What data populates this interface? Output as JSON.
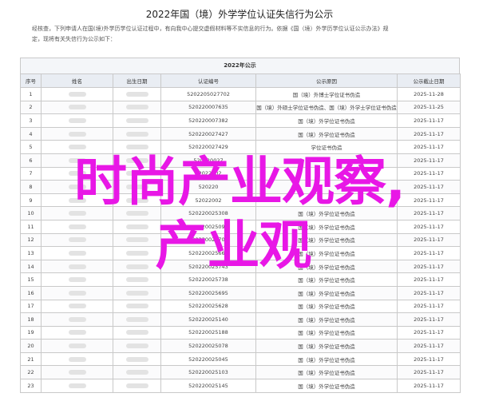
{
  "page": {
    "title": "2022年国（境）外学学位认证失信行为公示",
    "intro_line1": "经核查，下列申请人在国(境)外学历学位认证过程中，有向我中心提交虚假材料等不实信息的行为。依据《国（境）外学历学位认证公示办法》规",
    "intro_line2": "定，现将有关失信行为公示如下："
  },
  "table": {
    "caption": "2022年公示",
    "headers": [
      "序号",
      "姓名",
      "出生日期",
      "认证编号",
      "公示原因",
      "公示截止日期"
    ],
    "rows": [
      {
        "no": "1",
        "cert": "5202205027702",
        "reason": "国（境）外博士学位证书伪造",
        "date": "2025-11-28"
      },
      {
        "no": "2",
        "cert": "520220007635",
        "reason": "国（境）外硕士学位证书伪造、国（境）外学士学位证书伪造",
        "date": "2025-11-25"
      },
      {
        "no": "3",
        "cert": "520220007382",
        "reason": "国（境）外学位证书伪造",
        "date": "2025-11-17"
      },
      {
        "no": "4",
        "cert": "520220027427",
        "reason": "国（境）外学位证书伪造",
        "date": "2025-11-17"
      },
      {
        "no": "5",
        "cert": "520220027429",
        "reason": "学位证书伪造",
        "date": "2025-11-17"
      },
      {
        "no": "6",
        "cert": "520220027",
        "reason": "",
        "date": "2025-11-17"
      },
      {
        "no": "7",
        "cert": "52022002",
        "reason": "",
        "date": "2025-11-17"
      },
      {
        "no": "8",
        "cert": "520220",
        "reason": "",
        "date": "2025-11-17"
      },
      {
        "no": "9",
        "cert": "52022002",
        "reason": "",
        "date": "2025-11-17"
      },
      {
        "no": "10",
        "cert": "520220025308",
        "reason": "国（境）外学位证书伪造",
        "date": "2025-11-17"
      },
      {
        "no": "11",
        "cert": "520220025092",
        "reason": "国（境）外学位证书伪造",
        "date": "2025-11-17"
      },
      {
        "no": "12",
        "cert": "520220026702",
        "reason": "国（境）外学位证书伪造",
        "date": "2025-11-17"
      },
      {
        "no": "13",
        "cert": "520220025662",
        "reason": "国（境）外学位证书伪造",
        "date": "2025-11-17"
      },
      {
        "no": "14",
        "cert": "520220025743",
        "reason": "国（境）外学位证书伪造",
        "date": "2025-11-17"
      },
      {
        "no": "15",
        "cert": "520220025738",
        "reason": "国（境）外学位证书伪造",
        "date": "2025-11-17"
      },
      {
        "no": "16",
        "cert": "520220025695",
        "reason": "国（境）外学位证书伪造",
        "date": "2025-11-17"
      },
      {
        "no": "17",
        "cert": "520220025628",
        "reason": "国（境）外学位证书伪造",
        "date": "2025-11-17"
      },
      {
        "no": "18",
        "cert": "520220025140",
        "reason": "国（境）外学位证书伪造",
        "date": "2025-11-17"
      },
      {
        "no": "19",
        "cert": "520220025188",
        "reason": "国（境）外学位证书伪造",
        "date": "2025-11-17"
      },
      {
        "no": "20",
        "cert": "520220025078",
        "reason": "国（境）外学位证书伪造",
        "date": "2025-11-17"
      },
      {
        "no": "21",
        "cert": "520220025045",
        "reason": "国（境）外学位证书伪造",
        "date": "2025-11-17"
      },
      {
        "no": "22",
        "cert": "520220025103",
        "reason": "国（境）外学位证书伪造",
        "date": "2025-11-17"
      },
      {
        "no": "23",
        "cert": "520220025145",
        "reason": "国（境）外学位证书伪造",
        "date": "2025-11-17"
      }
    ]
  },
  "overlay": {
    "line1": "时尚产业观察,",
    "line2": "产业观",
    "color": "#e817e6"
  }
}
